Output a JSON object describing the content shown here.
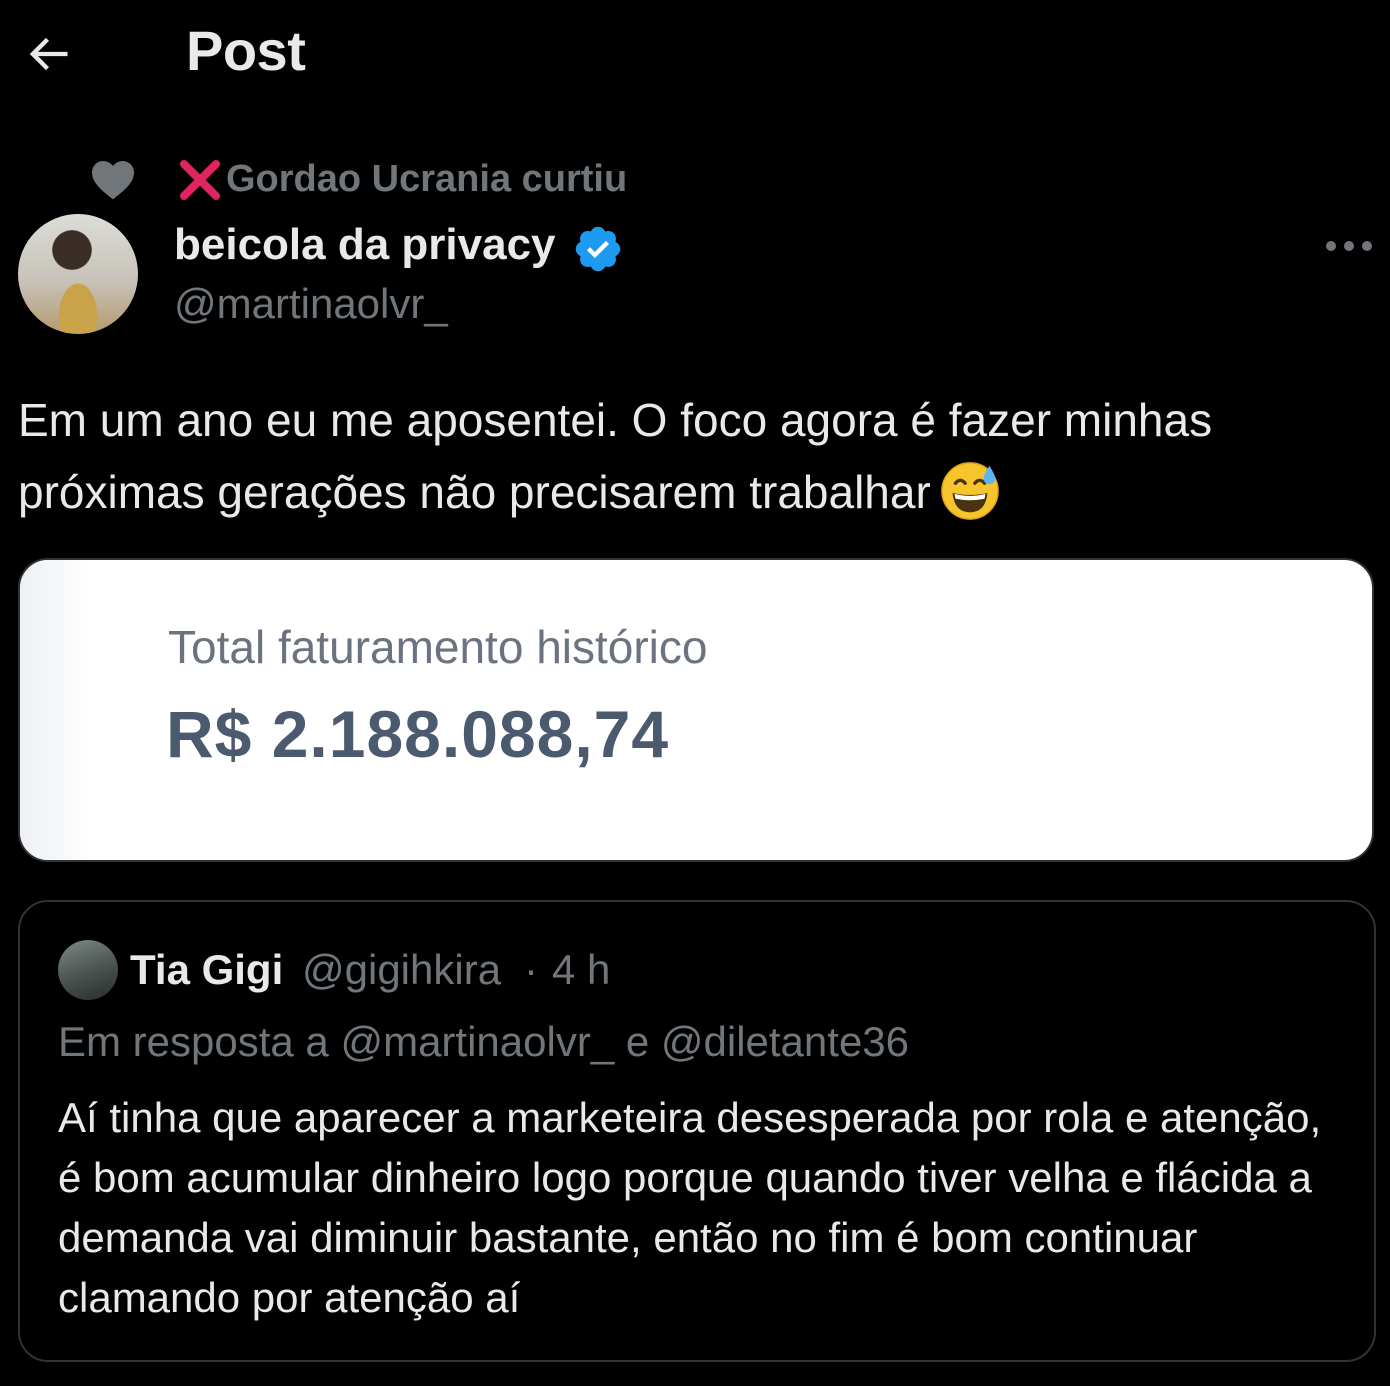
{
  "header": {
    "back_icon": "arrow-left-icon",
    "title": "Post"
  },
  "social_context": {
    "icon": "heart-icon",
    "badge_icon": "red-x-icon",
    "text": "Gordao Ucrania curtiu"
  },
  "post": {
    "author": {
      "display_name": "beicola da privacy",
      "verified_icon": "verified-badge-icon",
      "handle": "@martinaolvr_"
    },
    "more_icon": "more-horizontal-icon",
    "text": "Em um ano eu me aposentei. O foco agora é fazer minhas próximas gerações não precisarem trabalhar",
    "emoji": "grinning-face-with-sweat-emoji",
    "media": {
      "label": "Total faturamento histórico",
      "value": "R$ 2.188.088,74"
    }
  },
  "quoted_reply": {
    "author": {
      "display_name": "Tia Gigi",
      "handle": "@gigihkira"
    },
    "separator": "·",
    "time": "4 h",
    "reply_context": "Em resposta a @martinaolvr_ e @diletante36",
    "text": "Aí tinha que aparecer a marketeira desesperada por rola e atenção, é bom acumular dinheiro logo porque quando tiver velha e flácida a demanda vai diminuir bastante, então no fim é bom continuar clamando por atenção aí"
  },
  "colors": {
    "background": "#000000",
    "text_primary": "#e7e9ea",
    "text_secondary": "#71767b",
    "verified_blue": "#1d9bf0",
    "border": "#2f3336",
    "x_red": "#e0245e"
  }
}
